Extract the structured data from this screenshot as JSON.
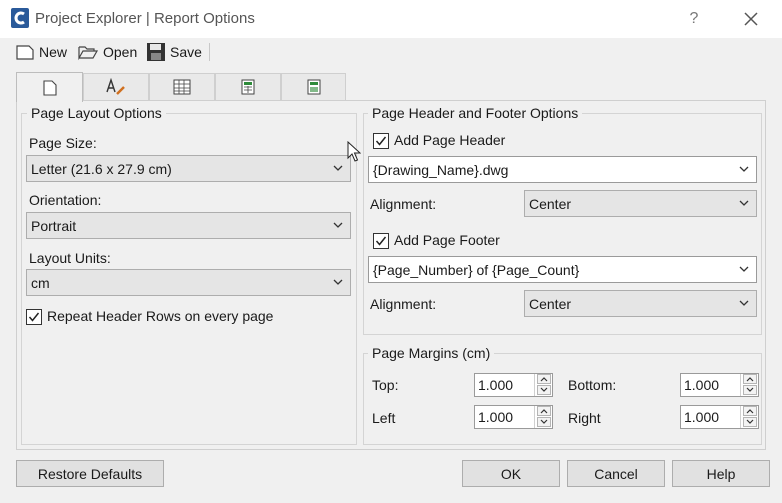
{
  "window": {
    "title": "Project Explorer | Report Options",
    "help_glyph": "?"
  },
  "toolbar": {
    "new_label": "New",
    "open_label": "Open",
    "save_label": "Save"
  },
  "page_layout": {
    "legend": "Page Layout Options",
    "page_size_label": "Page Size:",
    "page_size_value": "Letter (21.6 x 27.9 cm)",
    "orientation_label": "Orientation:",
    "orientation_value": "Portrait",
    "layout_units_label": "Layout Units:",
    "layout_units_value": "cm",
    "repeat_header_label": "Repeat Header Rows on every page"
  },
  "header_footer": {
    "legend": "Page Header and Footer Options",
    "add_header_label": "Add Page Header",
    "header_value": "{Drawing_Name}.dwg",
    "header_alignment_label": "Alignment:",
    "header_alignment_value": "Center",
    "add_footer_label": "Add Page Footer",
    "footer_value": "{Page_Number} of {Page_Count}",
    "footer_alignment_label": "Alignment:",
    "footer_alignment_value": "Center"
  },
  "margins": {
    "legend": "Page Margins (cm)",
    "top_label": "Top:",
    "top_value": "1.000",
    "bottom_label": "Bottom:",
    "bottom_value": "1.000",
    "left_label": "Left",
    "left_value": "1.000",
    "right_label": "Right",
    "right_value": "1.000"
  },
  "footer_buttons": {
    "restore_label": "Restore Defaults",
    "ok_label": "OK",
    "cancel_label": "Cancel",
    "help_label": "Help"
  },
  "colors": {
    "accent_blue": "#1a6fd4",
    "icon_green": "#2e8b3a"
  }
}
